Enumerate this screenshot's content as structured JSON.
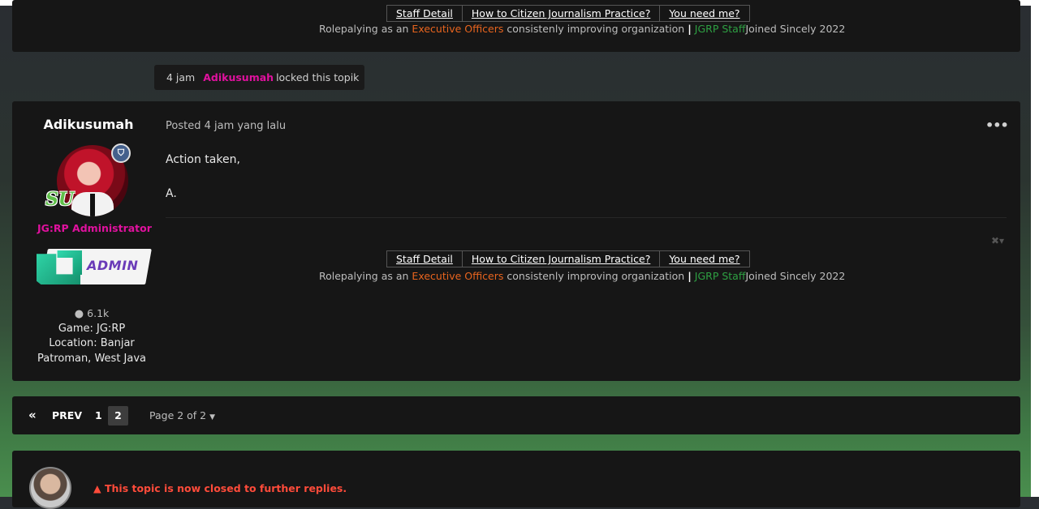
{
  "signature": {
    "links": [
      "Staff Detail",
      "How to Citizen Journalism Practice?",
      "You need me?"
    ],
    "line_pre": "Rolepalying as an",
    "line_role": "Executive Officers",
    "line_mid": "consistenly improving organization",
    "line_sep": "|",
    "line_staff": "JGRP Staff",
    "line_post": "Joined Sincely 2022"
  },
  "event": {
    "time": "4 jam",
    "user": "Adikusumah",
    "action": "locked this topik"
  },
  "post": {
    "author": "Adikusumah",
    "shield_glyph": "⛉",
    "rank_mark": "SU",
    "group": "JG:RP Administrator",
    "badge_label": "ADMIN",
    "post_count": "6.1k",
    "game": "Game: JG:RP",
    "location_line1": "Location: Banjar",
    "location_line2": "Patroman, West Java",
    "posted": "Posted 4 jam yang lalu",
    "body_line1": "Action taken,",
    "body_line2": "A.",
    "more_glyph": "•••",
    "mod_glyph": "✖▾"
  },
  "pagination": {
    "first_glyph": "«",
    "prev": "PREV",
    "pages": [
      "1",
      "2"
    ],
    "current": "2",
    "page_of": "Page 2 of 2"
  },
  "closed": {
    "message": "This topic is now closed to further replies.",
    "warn_glyph": "▲"
  },
  "colors": {
    "accent_pink": "#e0119e",
    "orange": "#e8641e",
    "green": "#2ea043",
    "warning_red": "#ff4b3a",
    "panel": "#161616"
  },
  "icons": [
    "more-options-icon",
    "comment-icon",
    "shield-icon",
    "moderation-icon",
    "double-chevron-left-icon",
    "caret-down-icon",
    "warning-icon"
  ]
}
